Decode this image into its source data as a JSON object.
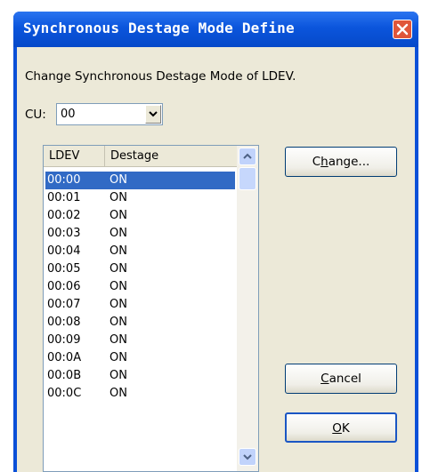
{
  "window": {
    "title": "Synchronous Destage Mode Define",
    "close_icon": "close-icon",
    "accent": "#0a50d8",
    "close_color": "#e0563a"
  },
  "description": "Change Synchronous Destage Mode of LDEV.",
  "cu": {
    "label": "CU:",
    "value": "00"
  },
  "list": {
    "columns": [
      "LDEV",
      "Destage"
    ],
    "rows": [
      {
        "ldev": "00:00",
        "destage": "ON",
        "selected": true
      },
      {
        "ldev": "00:01",
        "destage": "ON"
      },
      {
        "ldev": "00:02",
        "destage": "ON"
      },
      {
        "ldev": "00:03",
        "destage": "ON"
      },
      {
        "ldev": "00:04",
        "destage": "ON"
      },
      {
        "ldev": "00:05",
        "destage": "ON"
      },
      {
        "ldev": "00:06",
        "destage": "ON"
      },
      {
        "ldev": "00:07",
        "destage": "ON"
      },
      {
        "ldev": "00:08",
        "destage": "ON"
      },
      {
        "ldev": "00:09",
        "destage": "ON"
      },
      {
        "ldev": "00:0A",
        "destage": "ON"
      },
      {
        "ldev": "00:0B",
        "destage": "ON"
      },
      {
        "ldev": "00:0C",
        "destage": "ON"
      }
    ],
    "selection_color": "#316ac5"
  },
  "buttons": {
    "change": {
      "pre": "C",
      "u": "h",
      "post": "ange..."
    },
    "cancel": {
      "pre": "",
      "u": "C",
      "post": "ancel"
    },
    "ok": {
      "pre": "",
      "u": "O",
      "post": "K"
    }
  }
}
